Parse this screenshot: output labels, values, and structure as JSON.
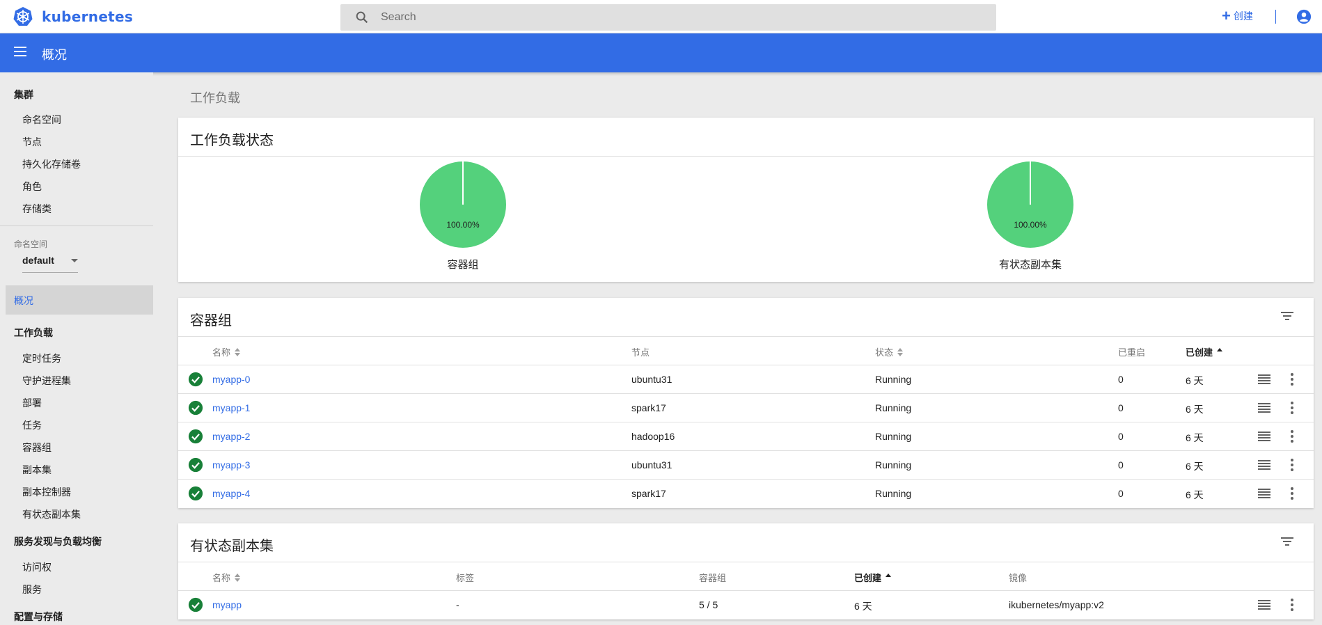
{
  "app": {
    "name": "kubernetes",
    "logo_icon": "kubernetes-logo-icon",
    "brand_color": "#326ce5"
  },
  "search": {
    "placeholder": "Search"
  },
  "topbar": {
    "create_label": "创建"
  },
  "toolbar": {
    "title": "概况"
  },
  "sidebar": {
    "cluster_header": "集群",
    "cluster_items": [
      "命名空间",
      "节点",
      "持久化存储卷",
      "角色",
      "存储类"
    ],
    "namespace_label": "命名空间",
    "namespace_value": "default",
    "overview_label": "概况",
    "workload_header": "工作负载",
    "workload_items": [
      "定时任务",
      "守护进程集",
      "部署",
      "任务",
      "容器组",
      "副本集",
      "副本控制器",
      "有状态副本集"
    ],
    "discovery_header": "服务发现与负载均衡",
    "discovery_items": [
      "访问权",
      "服务"
    ],
    "config_header": "配置与存储"
  },
  "main": {
    "heading": "工作负载",
    "status_card": {
      "title": "工作负载状态",
      "charts": [
        {
          "label": "容器组",
          "percent_text": "100.00%",
          "running_fraction": 1.0,
          "color": "#54d17c"
        },
        {
          "label": "有状态副本集",
          "percent_text": "100.00%",
          "running_fraction": 1.0,
          "color": "#54d17c"
        }
      ]
    },
    "pods_card": {
      "title": "容器组",
      "columns": {
        "name": "名称",
        "node": "节点",
        "status": "状态",
        "restarts": "已重启",
        "created": "已创建"
      },
      "rows": [
        {
          "name": "myapp-0",
          "node": "ubuntu31",
          "status": "Running",
          "restarts": "0",
          "created": "6 天"
        },
        {
          "name": "myapp-1",
          "node": "spark17",
          "status": "Running",
          "restarts": "0",
          "created": "6 天"
        },
        {
          "name": "myapp-2",
          "node": "hadoop16",
          "status": "Running",
          "restarts": "0",
          "created": "6 天"
        },
        {
          "name": "myapp-3",
          "node": "ubuntu31",
          "status": "Running",
          "restarts": "0",
          "created": "6 天"
        },
        {
          "name": "myapp-4",
          "node": "spark17",
          "status": "Running",
          "restarts": "0",
          "created": "6 天"
        }
      ]
    },
    "statefulsets_card": {
      "title": "有状态副本集",
      "columns": {
        "name": "名称",
        "labels": "标签",
        "pods": "容器组",
        "created": "已创建",
        "image": "镜像"
      },
      "rows": [
        {
          "name": "myapp",
          "labels": "-",
          "pods": "5 / 5",
          "created": "6 天",
          "image": "ikubernetes/myapp:v2"
        }
      ]
    }
  },
  "colors": {
    "accent": "#326ce5",
    "success": "#188038",
    "pie": "#54d17c"
  }
}
